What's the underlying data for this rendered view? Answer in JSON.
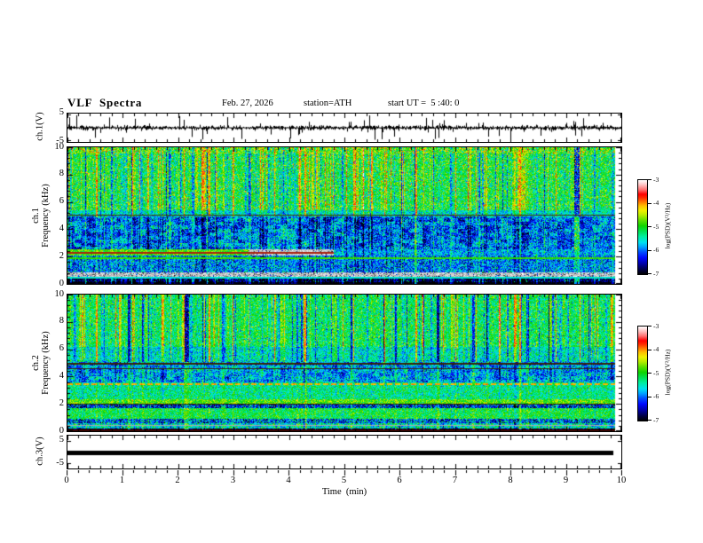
{
  "header": {
    "title": "VLF  Spectra",
    "date": "Feb. 27, 2026",
    "station": "station=ATH",
    "start_ut": "start UT =  5 :40: 0"
  },
  "xaxis": {
    "label": "Time  (min)",
    "ticks": [
      0,
      1,
      2,
      3,
      4,
      5,
      6,
      7,
      8,
      9,
      10
    ],
    "minor_step": 0.2,
    "range": [
      0,
      10
    ]
  },
  "panels": {
    "wave1": {
      "ylabel": "ch.1(V)",
      "yticks": [
        5,
        -5
      ],
      "ylim": [
        -5,
        5
      ]
    },
    "spec1": {
      "ylabel_ch": "ch.1",
      "ylabel_axis": "Frequency (kHz)",
      "yticks": [
        10,
        8,
        6,
        4,
        2,
        0
      ],
      "ylim": [
        0,
        10
      ]
    },
    "spec2": {
      "ylabel_ch": "ch.2",
      "ylabel_axis": "Frequency (kHz)",
      "yticks": [
        10,
        8,
        6,
        4,
        2,
        0
      ],
      "ylim": [
        0,
        10
      ]
    },
    "wave3": {
      "ylabel": "ch.3(V)",
      "yticks": [
        5,
        -5
      ],
      "ylim": [
        -5,
        5
      ]
    }
  },
  "colorbar": {
    "label": "log(PSD)(V²/Hz)",
    "ticks": [
      -3,
      -4,
      -5,
      -6,
      -7
    ],
    "range": [
      -7,
      -3
    ],
    "stops": [
      [
        -7.0,
        "#000000"
      ],
      [
        -6.8,
        "#000046"
      ],
      [
        -6.55,
        "#0000a8"
      ],
      [
        -6.3,
        "#0008ff"
      ],
      [
        -6.05,
        "#0050ff"
      ],
      [
        -5.85,
        "#00a2ff"
      ],
      [
        -5.65,
        "#00e0f0"
      ],
      [
        -5.4,
        "#00eea0"
      ],
      [
        -5.15,
        "#00e04a"
      ],
      [
        -4.95,
        "#0cd400"
      ],
      [
        -4.7,
        "#62e000"
      ],
      [
        -4.5,
        "#b4ec00"
      ],
      [
        -4.3,
        "#f0f000"
      ],
      [
        -4.1,
        "#ffc000"
      ],
      [
        -3.92,
        "#ff7300"
      ],
      [
        -3.75,
        "#ff2a00"
      ],
      [
        -3.6,
        "#ff0000"
      ],
      [
        -3.42,
        "#ff6b6b"
      ],
      [
        -3.2,
        "#ffc3c3"
      ],
      [
        -3.0,
        "#ffffff"
      ]
    ]
  },
  "chart_data": [
    {
      "type": "line",
      "name": "ch1-waveform",
      "ylabel": "ch.1(V)",
      "xlim": [
        0,
        10
      ],
      "ylim": [
        -5,
        5
      ],
      "baseline_v": 0,
      "noise_sigma_v": 0.6,
      "spike_p": 0.04,
      "spike_max_v": 5,
      "data_end": 10
    },
    {
      "type": "heatmap",
      "name": "ch1-spectrogram",
      "xlim": [
        0,
        10
      ],
      "ylim": [
        0,
        10
      ],
      "value_range": [
        -7,
        -3
      ],
      "data_end": 9.88,
      "bands": [
        {
          "f0": 9.55,
          "f1": 10.05,
          "base": -4.95,
          "sigma": 0.4,
          "streak": -0.9,
          "fl": [
            [
              0.06,
              -3.9
            ],
            [
              0.1,
              -4.3
            ]
          ]
        },
        {
          "f0": 5.4,
          "f1": 9.55,
          "base": -5.1,
          "sigma": 0.33,
          "streak": -1.15,
          "fl": [
            [
              0.05,
              -4.35
            ],
            [
              0.012,
              -3.9
            ],
            [
              0.03,
              -5.9
            ]
          ]
        },
        {
          "f0": 5.0,
          "f1": 5.4,
          "base": -5.5,
          "sigma": 0.3,
          "streak": -0.6
        },
        {
          "f0": 2.55,
          "f1": 5.0,
          "base": -6.0,
          "sigma": 0.38,
          "streak": 0.75,
          "patch": 0.4,
          "fl": [
            [
              0.02,
              -5.3
            ]
          ]
        },
        {
          "f0": 2.1,
          "f1": 2.55,
          "base": -4.8,
          "sigma": 0.3,
          "streak": 0.2,
          "seg": [
            {
              "t0": 3.3,
              "t1": 4.85,
              "gray": 205,
              "graySigma": 25,
              "darkp": 0.1
            },
            {
              "t0": 4.85,
              "t1": 10.1,
              "base": -5.8,
              "sigma": 0.35,
              "streak": 0.5
            }
          ]
        },
        {
          "f0": 0.9,
          "f1": 2.1,
          "base": -5.95,
          "sigma": 0.4,
          "streak": 0.5,
          "fl": [
            [
              0.04,
              -5.0
            ]
          ]
        },
        {
          "f0": 0.52,
          "f1": 0.9,
          "gray": 200,
          "graySigma": 28,
          "darkp": 0.13,
          "streak": 0.3
        },
        {
          "f0": 0.15,
          "f1": 0.52,
          "base": -6.75,
          "sigma": 0.3,
          "streak": 1.3,
          "fl": [
            [
              0.05,
              -5.3
            ]
          ]
        },
        {
          "f0": -0.05,
          "f1": 0.15,
          "base": -7.0,
          "sigma": 0.08,
          "streak": 1.0
        }
      ],
      "lines": [
        {
          "f": 5.07,
          "hw": 0.05,
          "color": "#4a2a10"
        },
        {
          "f": 2.32,
          "hw": 0.07,
          "color": "#aa2211",
          "t1": 4.85
        },
        {
          "f": 1.92,
          "hw": 0.06,
          "v": -4.85
        },
        {
          "f": 0.47,
          "hw": 0.05,
          "v": -5.55
        }
      ],
      "streaks": {
        "density": 0.38,
        "sigma": 0.55,
        "carry": 0.25,
        "red_times": [
          0.52,
          1.18,
          2.12,
          2.58,
          3.02,
          3.78,
          4.32,
          5.22,
          5.78,
          6.35,
          7.08,
          7.45,
          8.25,
          8.92,
          9.35
        ],
        "red_value": -4.05,
        "red_sigma": 0.3
      }
    },
    {
      "type": "heatmap",
      "name": "ch2-spectrogram",
      "xlim": [
        0,
        10
      ],
      "ylim": [
        0,
        10
      ],
      "value_range": [
        -7,
        -3
      ],
      "data_end": 9.88,
      "bands": [
        {
          "f0": 6.2,
          "f1": 10.05,
          "base": -5.2,
          "sigma": 0.3,
          "streak": -1.2,
          "fl": [
            [
              0.04,
              -4.4
            ],
            [
              0.01,
              -6.3
            ]
          ]
        },
        {
          "f0": 5.1,
          "f1": 6.2,
          "base": -5.5,
          "sigma": 0.33,
          "streak": -0.9
        },
        {
          "f0": 3.6,
          "f1": 5.1,
          "base": -5.8,
          "sigma": 0.36,
          "streak": 0.55,
          "patch": 0.3,
          "fl": [
            [
              0.02,
              -6.6
            ]
          ]
        },
        {
          "f0": 2.4,
          "f1": 3.6,
          "base": -5.3,
          "sigma": 0.3,
          "streak": 0.3,
          "fl": [
            [
              0.05,
              -5.7
            ]
          ]
        },
        {
          "f0": 2.05,
          "f1": 2.4,
          "base": -4.85,
          "sigma": 0.28,
          "streak": 0.2,
          "fl": [
            [
              0.12,
              -4.35
            ]
          ]
        },
        {
          "f0": 1.7,
          "f1": 2.05,
          "base": -6.3,
          "sigma": 0.45,
          "streak": 0.4,
          "fl": [
            [
              0.08,
              -4.9
            ]
          ]
        },
        {
          "f0": 0.95,
          "f1": 1.7,
          "base": -5.15,
          "sigma": 0.3,
          "streak": 0.3,
          "fl": [
            [
              0.05,
              -4.6
            ]
          ]
        },
        {
          "f0": 0.6,
          "f1": 0.95,
          "base": -6.1,
          "sigma": 0.5,
          "streak": 0.5,
          "fl": [
            [
              0.1,
              -5.0
            ]
          ]
        },
        {
          "f0": 0.22,
          "f1": 0.6,
          "base": -5.5,
          "sigma": 0.4,
          "streak": 0.6
        },
        {
          "f0": -0.05,
          "f1": 0.22,
          "base": -6.95,
          "sigma": 0.1,
          "streak": 1.1
        }
      ],
      "lines": [
        {
          "f": 4.97,
          "hw": 0.06,
          "color": "#3a2408"
        },
        {
          "f": 4.62,
          "hw": 0.05,
          "color": "#33260d"
        },
        {
          "f": 3.47,
          "hw": 0.08,
          "v": -4.05,
          "dash": [
            6,
            3
          ]
        },
        {
          "f": 2.03,
          "hw": 0.04,
          "color": "#2a2a00"
        },
        {
          "f": 0.44,
          "hw": 0.05,
          "color": "#a8a8a8"
        },
        {
          "f": 0.07,
          "hw": 0.06,
          "color": "#3a0500"
        }
      ],
      "streaks": {
        "density": 0.38,
        "sigma": 0.55,
        "carry": 0.25,
        "red_times": [
          0.52,
          1.18,
          2.12,
          2.58,
          3.02,
          3.78,
          4.32,
          5.22,
          5.78,
          6.35,
          7.08,
          7.45,
          8.25,
          8.92,
          9.35
        ],
        "red_value": -4.05,
        "red_sigma": 0.3
      }
    },
    {
      "type": "line",
      "name": "ch3-waveform",
      "ylabel": "ch.3(V)",
      "xlim": [
        0,
        10
      ],
      "ylim": [
        -5,
        5
      ],
      "constant_value": 0,
      "x_start": 0,
      "x_end": 9.85
    }
  ]
}
